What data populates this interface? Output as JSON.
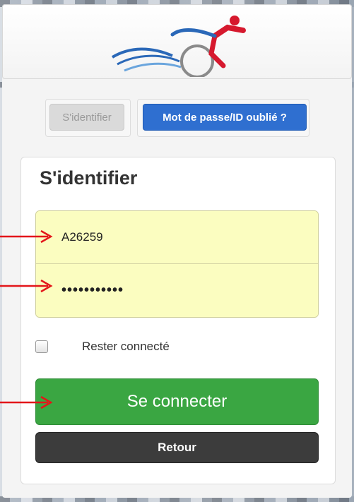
{
  "tabs": {
    "identify_label": "S'identifier",
    "forgot_label": "Mot de passe/ID oublié ?"
  },
  "login": {
    "title": "S'identifier",
    "username_value": "A26259",
    "password_value": "•••••••••••",
    "remember_label": "Rester connecté",
    "remember_checked": false,
    "connect_label": "Se connecter",
    "back_label": "Retour"
  },
  "colors": {
    "primary_blue": "#2f6fd0",
    "connect_green": "#3aa642",
    "back_dark": "#3c3c3c",
    "field_yellow": "#fbfdc0",
    "annotation_red": "#e3161a"
  },
  "icons": {
    "logo": "cyclist-logo",
    "annotation": "red-arrow-icon"
  }
}
